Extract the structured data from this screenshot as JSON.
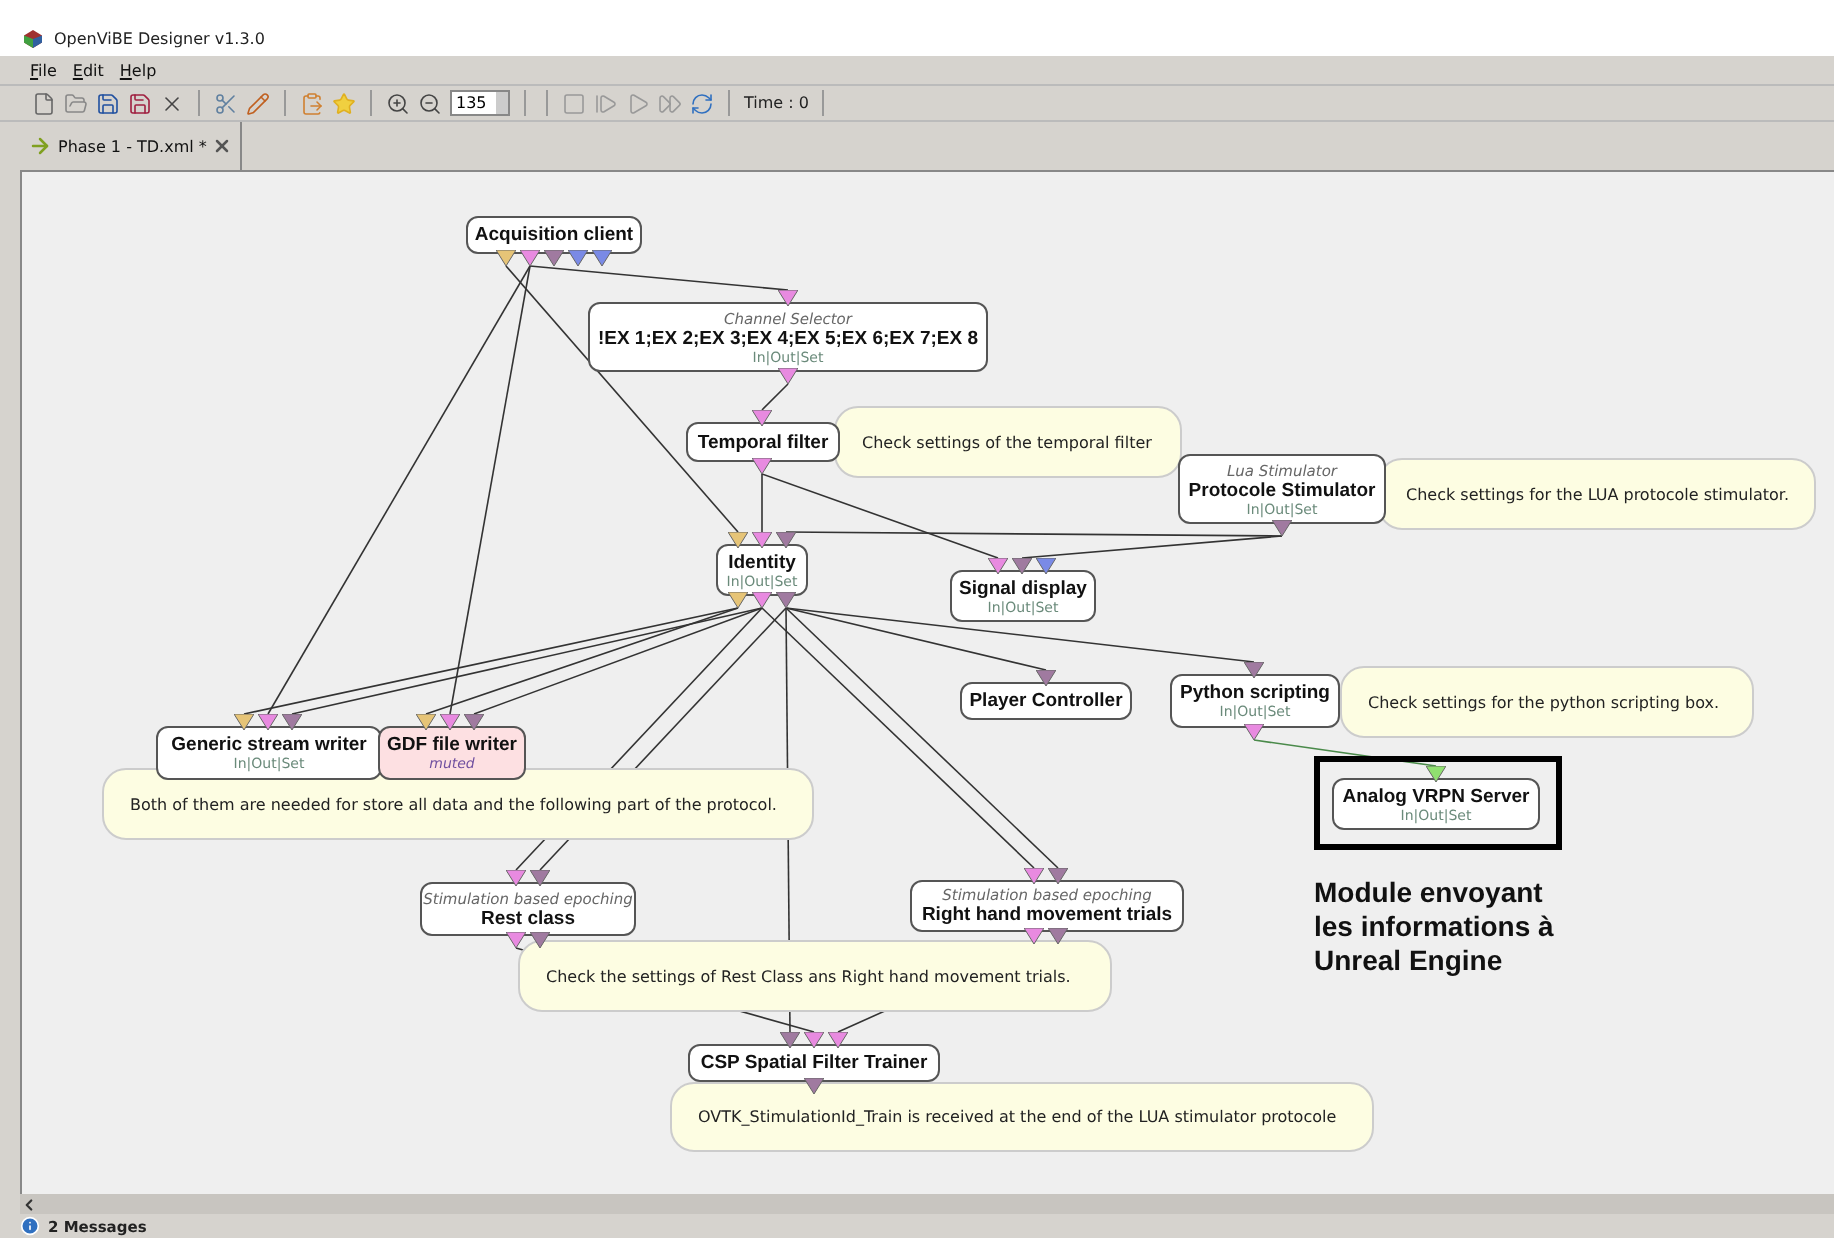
{
  "window": {
    "title": "OpenViBE Designer v1.3.0"
  },
  "menu": [
    {
      "label": "File"
    },
    {
      "label": "Edit"
    },
    {
      "label": "Help"
    }
  ],
  "toolbar": {
    "zoom": "135",
    "time": "Time : 0"
  },
  "tabs": [
    {
      "label": "Phase 1 - TD.xml *",
      "selected": true
    }
  ],
  "scenario": {
    "boxes": [
      {
        "name": "Acquisition client",
        "highlighted": false,
        "muted": false,
        "outputs": [
          {
            "color": "#e6c477"
          },
          {
            "color": "#e88ae0"
          },
          {
            "color": "#a07aa0"
          },
          {
            "color": "#7a8ae6"
          },
          {
            "color": "#7a8ae6"
          }
        ]
      },
      {
        "type": "Channel Selector",
        "name": "!EX 1;EX 2;EX 3;EX 4;EX 5;EX 6;EX 7;EX 8",
        "io": "In|Out|Set",
        "highlighted": false,
        "muted": false,
        "inputs": [
          {
            "color": "#e88ae0"
          }
        ],
        "outputs": [
          {
            "color": "#e88ae0"
          }
        ]
      },
      {
        "name": "Temporal filter",
        "highlighted": false,
        "muted": false,
        "inputs": [
          {
            "color": "#e88ae0"
          }
        ],
        "outputs": [
          {
            "color": "#e88ae0"
          }
        ]
      },
      {
        "type": "Lua Stimulator",
        "name": "Protocole Stimulator",
        "io": "In|Out|Set",
        "highlighted": false,
        "muted": false,
        "outputs": [
          {
            "color": "#a07aa0"
          }
        ]
      },
      {
        "name": "Identity",
        "io": "In|Out|Set",
        "highlighted": false,
        "muted": false,
        "inputs": [
          {
            "color": "#e6c477"
          },
          {
            "color": "#e88ae0"
          },
          {
            "color": "#a07aa0"
          }
        ],
        "outputs": [
          {
            "color": "#e6c477"
          },
          {
            "color": "#e88ae0"
          },
          {
            "color": "#a07aa0"
          }
        ]
      },
      {
        "name": "Signal display",
        "io": "In|Out|Set",
        "highlighted": false,
        "muted": false,
        "inputs": [
          {
            "color": "#e88ae0"
          },
          {
            "color": "#a07aa0"
          },
          {
            "color": "#7a8ae6"
          }
        ]
      },
      {
        "name": "Player Controller",
        "highlighted": false,
        "muted": false,
        "inputs": [
          {
            "color": "#a07aa0"
          }
        ]
      },
      {
        "name": "Python scripting",
        "io": "In|Out|Set",
        "highlighted": false,
        "muted": false,
        "inputs": [
          {
            "color": "#a07aa0"
          }
        ],
        "outputs": [
          {
            "color": "#e88ae0"
          }
        ]
      },
      {
        "name": "Analog VRPN Server",
        "io": "In|Out|Set",
        "highlighted": true,
        "muted": false,
        "inputs": [
          {
            "color": "#90e070"
          }
        ]
      },
      {
        "name": "Generic stream writer",
        "io": "In|Out|Set",
        "highlighted": false,
        "muted": false,
        "inputs": [
          {
            "color": "#e6c477"
          },
          {
            "color": "#e88ae0"
          },
          {
            "color": "#a07aa0"
          }
        ]
      },
      {
        "name": "GDF file writer",
        "io": "muted",
        "highlighted": false,
        "muted": true,
        "inputs": [
          {
            "color": "#e6c477"
          },
          {
            "color": "#e88ae0"
          },
          {
            "color": "#a07aa0"
          }
        ]
      },
      {
        "type": "Stimulation based epoching",
        "name": "Rest class",
        "highlighted": false,
        "muted": false,
        "inputs": [
          {
            "color": "#e88ae0"
          },
          {
            "color": "#a07aa0"
          }
        ],
        "outputs": [
          {
            "color": "#e88ae0"
          },
          {
            "color": "#a07aa0"
          }
        ]
      },
      {
        "type": "Stimulation based epoching",
        "name": "Right hand movement trials",
        "highlighted": false,
        "muted": false,
        "inputs": [
          {
            "color": "#e88ae0"
          },
          {
            "color": "#a07aa0"
          }
        ],
        "outputs": [
          {
            "color": "#e88ae0"
          },
          {
            "color": "#a07aa0"
          }
        ]
      },
      {
        "name": "CSP Spatial Filter Trainer",
        "highlighted": false,
        "muted": false,
        "inputs": [
          {
            "color": "#a07aa0"
          },
          {
            "color": "#e88ae0"
          },
          {
            "color": "#e88ae0"
          }
        ],
        "outputs": [
          {
            "color": "#a07aa0"
          }
        ]
      }
    ],
    "comments": [
      "Check settings of the temporal filter",
      "Check settings for the LUA protocole stimulator.",
      "Check settings for the python scripting box.",
      "Both of them are needed for store all data and the following part of the protocol.",
      "Check the settings of Rest Class ans Right hand movement trials.",
      "OVTK_StimulationId_Train is received at the end of the LUA stimulator protocole"
    ],
    "note": [
      "Module envoyant",
      "les informations à",
      "Unreal Engine"
    ]
  },
  "status_bar": {
    "messages": "2 Messages"
  }
}
